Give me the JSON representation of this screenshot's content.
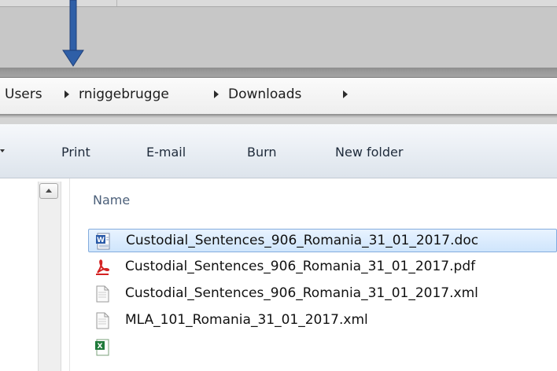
{
  "breadcrumb": {
    "items": [
      "Users",
      "rniggebrugge",
      "Downloads"
    ]
  },
  "toolbar": {
    "print": "Print",
    "email": "E-mail",
    "burn": "Burn",
    "new_folder": "New folder"
  },
  "file_list": {
    "column_name": "Name",
    "files": [
      {
        "name": "Custodial_Sentences_906_Romania_31_01_2017.doc",
        "icon": "word-doc-icon",
        "selected": true
      },
      {
        "name": "Custodial_Sentences_906_Romania_31_01_2017.pdf",
        "icon": "pdf-icon",
        "selected": false
      },
      {
        "name": "Custodial_Sentences_906_Romania_31_01_2017.xml",
        "icon": "xml-file-icon",
        "selected": false
      },
      {
        "name": "MLA_101_Romania_31_01_2017.xml",
        "icon": "xml-file-icon",
        "selected": false
      },
      {
        "name": "",
        "icon": "excel-icon",
        "selected": false
      }
    ]
  },
  "colors": {
    "arrow": "#2f5fa7",
    "highlight": "#f3f69a",
    "selection": "#cfe5fc"
  }
}
